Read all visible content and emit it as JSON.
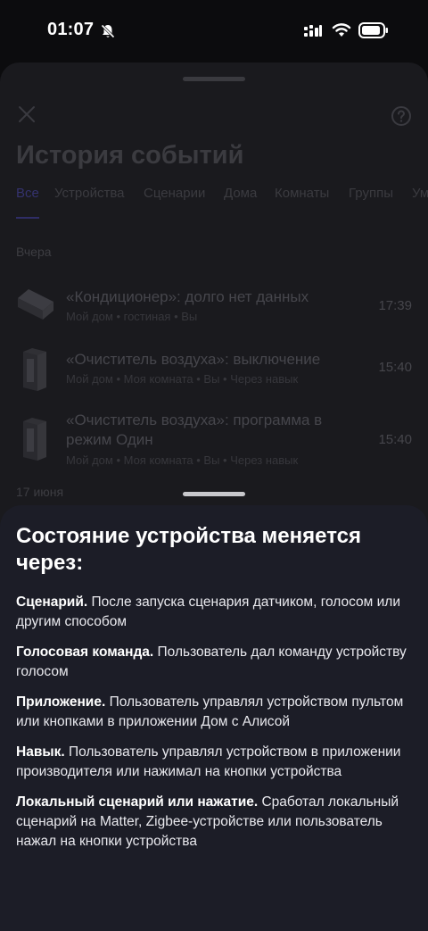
{
  "status_bar": {
    "time": "01:07"
  },
  "background": {
    "title": "История событий",
    "tabs": [
      "Все",
      "Устройства",
      "Сценарии",
      "Дома",
      "Комнаты",
      "Группы",
      "Ум"
    ],
    "sections": [
      {
        "label": "Вчера",
        "events": [
          {
            "title": "«Кондиционер»: долго нет данных",
            "subtitle": "Мой дом • гостиная • Вы",
            "time": "17:39",
            "icon": "air-conditioner-icon"
          },
          {
            "title": "«Очиститель воздуха»: выключение",
            "subtitle": "Мой дом • Моя комната • Вы • Через навык",
            "time": "15:40",
            "icon": "air-purifier-icon"
          },
          {
            "title": "«Очиститель воздуха»: программа в режим Один",
            "subtitle": "Мой дом • Моя комната • Вы • Через навык",
            "time": "15:40",
            "icon": "air-purifier-icon"
          }
        ]
      },
      {
        "label": "17 июня"
      }
    ]
  },
  "info_sheet": {
    "title": "Состояние устройства меняется через:",
    "items": [
      {
        "term": "Сценарий.",
        "text": " После запуска сценария датчиком, голосом или другим способом"
      },
      {
        "term": "Голосовая команда.",
        "text": " Пользователь дал команду устройству голосом"
      },
      {
        "term": "Приложение.",
        "text": " Пользователь управлял устройством пультом или кнопками в приложении Дом с Алисой"
      },
      {
        "term": "Навык.",
        "text": " Пользователь управлял устройством в приложении производителя или нажимал на кнопки устройства"
      },
      {
        "term": "Локальный сценарий или нажатие.",
        "text": " Сработал локальный сценарий на Matter, Zigbee-устройстве или пользователь нажал на кнопки устройства"
      }
    ]
  }
}
